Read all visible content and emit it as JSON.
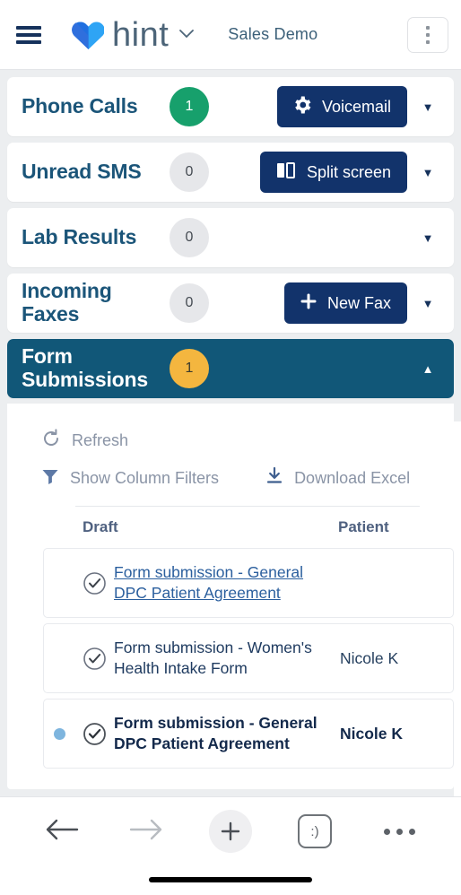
{
  "header": {
    "menu_icon": "hamburger-icon",
    "brand": "hint",
    "brand_caret": "⌄",
    "org_name": "Sales Demo",
    "kebab_label": "more-options"
  },
  "cards": [
    {
      "title": "Phone Calls",
      "count": "1",
      "badge_color": "#17a06c",
      "badge_style": "green",
      "action": {
        "label": "Voicemail",
        "icon": "gear-icon"
      },
      "caret": "▼",
      "expanded": false
    },
    {
      "title": "Unread SMS",
      "count": "0",
      "badge_color": "#e6e7ea",
      "badge_style": "grey",
      "action": {
        "label": "Split screen",
        "icon": "split-screen-icon"
      },
      "caret": "▼",
      "expanded": false
    },
    {
      "title": "Lab Results",
      "count": "0",
      "badge_color": "#e6e7ea",
      "badge_style": "grey",
      "action": null,
      "caret": "▼",
      "expanded": false
    },
    {
      "title": "Incoming Faxes",
      "count": "0",
      "badge_color": "#e6e7ea",
      "badge_style": "grey",
      "action": {
        "label": "New Fax",
        "icon": "plus-icon"
      },
      "caret": "▼",
      "expanded": false
    },
    {
      "title": "Form Submissions",
      "count": "1",
      "badge_color": "#f4b63f",
      "badge_style": "amber",
      "action": null,
      "caret": "▲",
      "expanded": true
    }
  ],
  "panel": {
    "toolbar": {
      "refresh": "Refresh",
      "filters": "Show Column Filters",
      "download": "Download Excel"
    },
    "table": {
      "columns": [
        "Draft",
        "Patient"
      ],
      "rows": [
        {
          "unread": false,
          "dot": false,
          "status_icon": "check-circle-icon",
          "draft": "Form submission - General DPC Patient Agreement",
          "draft_is_link": true,
          "patient": ""
        },
        {
          "unread": false,
          "dot": false,
          "status_icon": "check-circle-icon",
          "draft": "Form submission - Women's Health Intake Form",
          "draft_is_link": false,
          "patient": "Nicole K"
        },
        {
          "unread": true,
          "dot": true,
          "status_icon": "check-circle-icon",
          "draft": "Form submission - General DPC Patient Agreement",
          "draft_is_link": false,
          "patient": "Nicole K"
        }
      ]
    }
  },
  "browser_bar": {
    "back": "back-arrow",
    "forward": "forward-arrow",
    "new_tab": "plus-icon",
    "smiley": ":)",
    "more": "more-dots"
  },
  "colors": {
    "accent_navy": "#12336b",
    "heading_teal": "#1b5579",
    "expanded_bg": "#115778",
    "badge_green": "#17a06c",
    "badge_amber": "#f4b63f",
    "link_blue": "#2b5f9e",
    "unread_dot": "#7eb5de"
  }
}
